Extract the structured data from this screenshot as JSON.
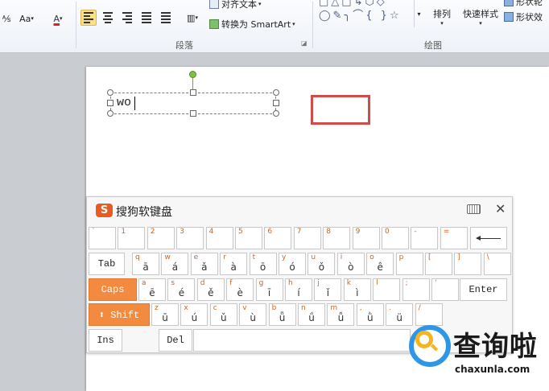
{
  "ribbon": {
    "font_case_label": "Aa",
    "font_color_label": "A",
    "align_text_label": "对齐文本",
    "convert_smartart_label": "转换为 SmartArt",
    "paragraph_group": "段落",
    "drawing_group": "绘图",
    "arrange_label": "排列",
    "quick_styles_label": "快速样式",
    "shape_fill_label": "形状轮",
    "shape_effects_label": "形状效"
  },
  "document": {
    "textbox_text": "wo"
  },
  "keyboard": {
    "title": "搜狗软键盘",
    "close": "✕",
    "rows": [
      [
        {
          "top": "`",
          "bottom": ""
        },
        {
          "top": "1",
          "bottom": ""
        },
        {
          "top": "2",
          "bottom": ""
        },
        {
          "top": "3",
          "bottom": ""
        },
        {
          "top": "4",
          "bottom": ""
        },
        {
          "top": "5",
          "bottom": ""
        },
        {
          "top": "6",
          "bottom": ""
        },
        {
          "top": "7",
          "bottom": ""
        },
        {
          "top": "8",
          "bottom": ""
        },
        {
          "top": "9",
          "bottom": ""
        },
        {
          "top": "0",
          "bottom": ""
        },
        {
          "top": "-",
          "bottom": ""
        },
        {
          "top": "=",
          "bottom": ""
        }
      ],
      [
        {
          "top": "q",
          "bottom": "ā"
        },
        {
          "top": "w",
          "bottom": "á"
        },
        {
          "top": "e",
          "bottom": "ǎ"
        },
        {
          "top": "r",
          "bottom": "à"
        },
        {
          "top": "t",
          "bottom": "ō"
        },
        {
          "top": "y",
          "bottom": "ó"
        },
        {
          "top": "u",
          "bottom": "ǒ"
        },
        {
          "top": "i",
          "bottom": "ò"
        },
        {
          "top": "o",
          "bottom": "ê"
        },
        {
          "top": "p",
          "bottom": ""
        },
        {
          "top": "[",
          "bottom": ""
        },
        {
          "top": "]",
          "bottom": ""
        },
        {
          "top": "\\",
          "bottom": ""
        }
      ],
      [
        {
          "top": "a",
          "bottom": "ē"
        },
        {
          "top": "s",
          "bottom": "é"
        },
        {
          "top": "d",
          "bottom": "ě"
        },
        {
          "top": "f",
          "bottom": "è"
        },
        {
          "top": "g",
          "bottom": "ī"
        },
        {
          "top": "h",
          "bottom": "í"
        },
        {
          "top": "j",
          "bottom": "ǐ"
        },
        {
          "top": "k",
          "bottom": "ì"
        },
        {
          "top": "l",
          "bottom": ""
        },
        {
          "top": ";",
          "bottom": ""
        },
        {
          "top": "'",
          "bottom": ""
        }
      ],
      [
        {
          "top": "z",
          "bottom": "ū"
        },
        {
          "top": "x",
          "bottom": "ú"
        },
        {
          "top": "c",
          "bottom": "ǔ"
        },
        {
          "top": "v",
          "bottom": "ù"
        },
        {
          "top": "b",
          "bottom": "ǖ"
        },
        {
          "top": "n",
          "bottom": "ǘ"
        },
        {
          "top": "m",
          "bottom": "ǚ"
        },
        {
          "top": ",",
          "bottom": "ǜ"
        },
        {
          "top": ".",
          "bottom": "ü"
        },
        {
          "top": "/",
          "bottom": ""
        }
      ]
    ],
    "tab_label": "Tab",
    "caps_label": "Caps",
    "enter_label": "Enter",
    "shift_label": "⬆ Shift",
    "ins_label": "Ins",
    "del_label": "Del"
  },
  "watermark": {
    "text": "查询啦",
    "url": "chaxunla.com"
  },
  "colors": {
    "accent_orange": "#f28a3f",
    "shape_red": "#d24b4b",
    "rotate_green": "#7dc143"
  }
}
